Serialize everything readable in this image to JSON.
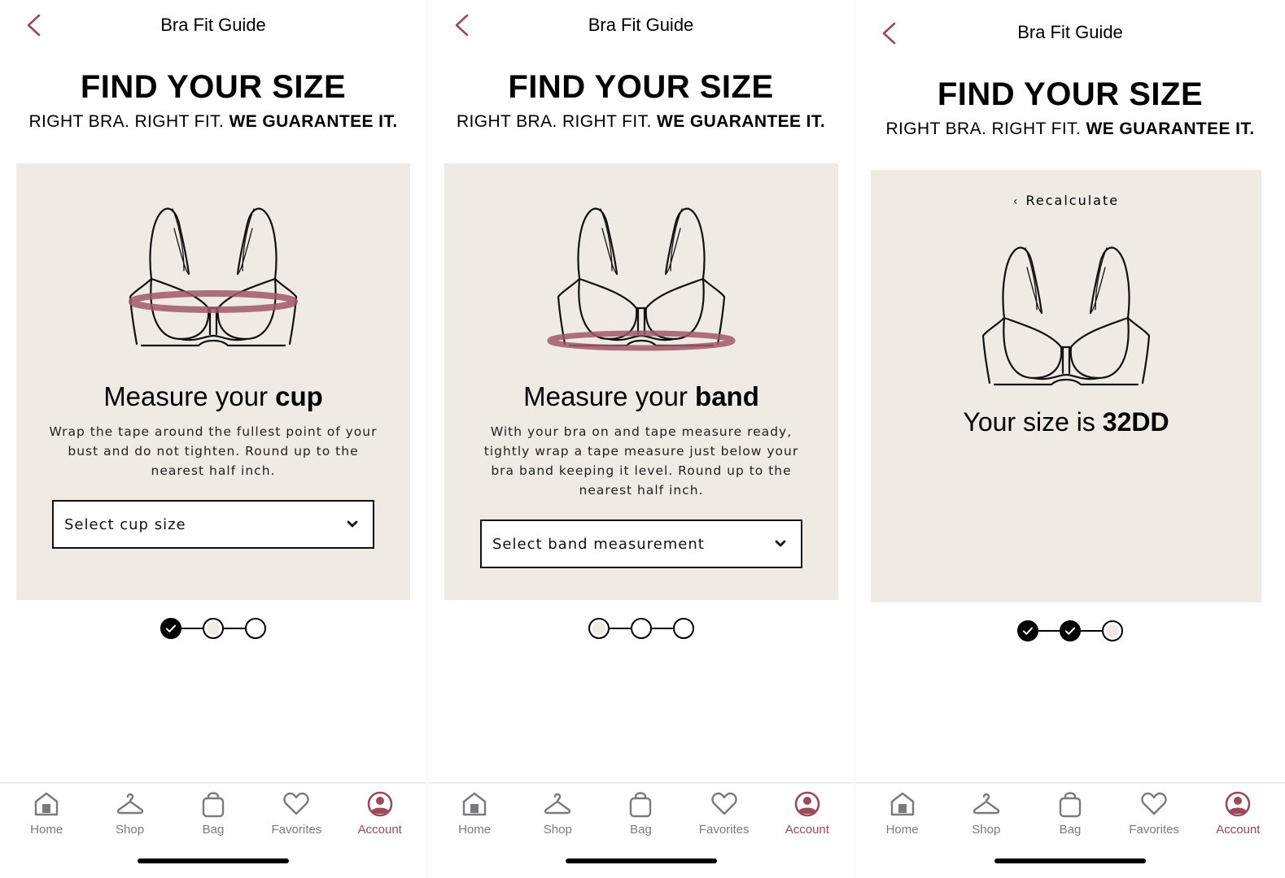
{
  "colors": {
    "accent": "#9c4a5a",
    "card_bg": "#efebe4",
    "tab_inactive": "#7a7a7e"
  },
  "header": {
    "title": "Bra Fit Guide",
    "back_icon": "chevron-left-icon"
  },
  "hero": {
    "title": "FIND YOUR SIZE",
    "subtitle_light": "RIGHT BRA. RIGHT FIT. ",
    "subtitle_bold": "WE GUARANTEE IT."
  },
  "screens": [
    {
      "step_title_light": "Measure your ",
      "step_title_bold": "cup",
      "description": "Wrap the tape around the fullest point of your bust and do not tighten. Round up to the nearest half inch.",
      "select_placeholder": "Select cup size",
      "measure_highlight": "bust",
      "stepper": [
        "done",
        "current",
        "empty"
      ]
    },
    {
      "step_title_light": "Measure your ",
      "step_title_bold": "band",
      "description": "With your bra on and tape measure ready, tightly wrap a tape measure just below your bra band keeping it level. Round up to the nearest half inch.",
      "select_placeholder": "Select band measurement",
      "measure_highlight": "band",
      "stepper": [
        "current",
        "empty",
        "empty"
      ]
    },
    {
      "recalculate_label": "Recalculate",
      "result_light": "Your size is ",
      "result_bold": "32DD",
      "stepper": [
        "done",
        "done",
        "current"
      ]
    }
  ],
  "tabbar": {
    "items": [
      {
        "label": "Home",
        "icon": "home-icon"
      },
      {
        "label": "Shop",
        "icon": "hanger-icon"
      },
      {
        "label": "Bag",
        "icon": "bag-icon"
      },
      {
        "label": "Favorites",
        "icon": "heart-icon"
      },
      {
        "label": "Account",
        "icon": "account-icon",
        "active": true
      }
    ]
  }
}
